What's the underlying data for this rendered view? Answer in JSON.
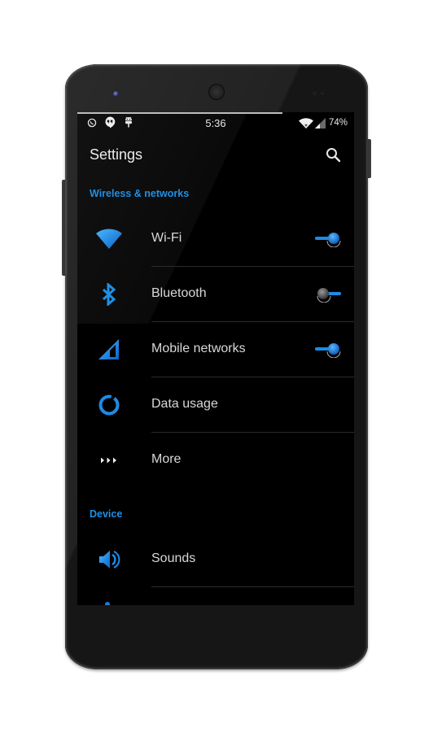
{
  "status_bar": {
    "notification_icons": [
      "whatsapp-icon",
      "hangouts-icon",
      "android-icon"
    ],
    "time": "5:36",
    "system_icons": [
      "wifi-icon",
      "cell-signal-icon"
    ],
    "battery": "74%"
  },
  "action_bar": {
    "title": "Settings",
    "search_icon": "search-icon"
  },
  "sections": [
    {
      "header": "Wireless & networks",
      "items": [
        {
          "label": "Wi-Fi",
          "icon": "wifi-icon",
          "toggle": true
        },
        {
          "label": "Bluetooth",
          "icon": "bluetooth-icon",
          "toggle": false
        },
        {
          "label": "Mobile networks",
          "icon": "cell-signal-icon",
          "toggle": true
        },
        {
          "label": "Data usage",
          "icon": "data-usage-icon",
          "toggle": null
        },
        {
          "label": "More",
          "icon": "more-icon",
          "toggle": null
        }
      ]
    },
    {
      "header": "Device",
      "items": [
        {
          "label": "Sounds",
          "icon": "volume-icon",
          "toggle": null
        }
      ]
    }
  ],
  "colors": {
    "accent": "#1e90e6",
    "background": "#000000",
    "text": "#d8d8d8"
  }
}
